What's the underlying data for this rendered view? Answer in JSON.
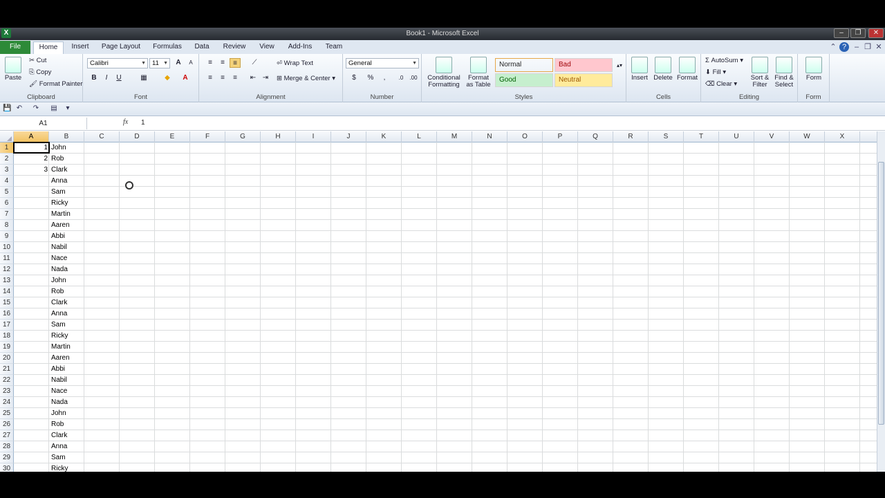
{
  "window": {
    "title": "Book1 - Microsoft Excel",
    "app_icon": "X"
  },
  "tabs": [
    "File",
    "Home",
    "Insert",
    "Page Layout",
    "Formulas",
    "Data",
    "Review",
    "View",
    "Add-Ins",
    "Team"
  ],
  "active_tab": "Home",
  "ribbon": {
    "clipboard": {
      "label": "Clipboard",
      "paste": "Paste",
      "cut": "Cut",
      "copy": "Copy",
      "format_painter": "Format Painter"
    },
    "font": {
      "label": "Font",
      "name": "Calibri",
      "size": "11",
      "bold": "B",
      "italic": "I",
      "underline": "U"
    },
    "alignment": {
      "label": "Alignment",
      "wrap": "Wrap Text",
      "merge": "Merge & Center"
    },
    "number": {
      "label": "Number",
      "format": "General",
      "percent": "%",
      "comma": ","
    },
    "styles": {
      "label": "Styles",
      "conditional": "Conditional Formatting",
      "format_table": "Format as Table",
      "normal": "Normal",
      "bad": "Bad",
      "good": "Good",
      "neutral": "Neutral",
      "colors": {
        "bad": "#ffc7ce",
        "good": "#c6efce",
        "neutral": "#ffeb9c",
        "normal": "#ffffff"
      }
    },
    "cells": {
      "label": "Cells",
      "insert": "Insert",
      "delete": "Delete",
      "format": "Format"
    },
    "editing": {
      "label": "Editing",
      "autosum": "AutoSum",
      "fill": "Fill",
      "clear": "Clear",
      "sort": "Sort & Filter",
      "find": "Find & Select"
    },
    "form": {
      "label": "Form",
      "form": "Form"
    }
  },
  "formula_bar": {
    "name_box": "A1",
    "fx": "fx",
    "value": "1"
  },
  "columns": [
    "A",
    "B",
    "C",
    "D",
    "E",
    "F",
    "G",
    "H",
    "I",
    "J",
    "K",
    "L",
    "M",
    "N",
    "O",
    "P",
    "Q",
    "R",
    "S",
    "T",
    "U",
    "V",
    "W",
    "X"
  ],
  "rows": [
    {
      "n": "1",
      "a": "1",
      "b": "John"
    },
    {
      "n": "2",
      "a": "2",
      "b": "Rob"
    },
    {
      "n": "3",
      "a": "3",
      "b": "Clark"
    },
    {
      "n": "4",
      "a": "",
      "b": "Anna"
    },
    {
      "n": "5",
      "a": "",
      "b": "Sam"
    },
    {
      "n": "6",
      "a": "",
      "b": "Ricky"
    },
    {
      "n": "7",
      "a": "",
      "b": "Martin"
    },
    {
      "n": "8",
      "a": "",
      "b": "Aaren"
    },
    {
      "n": "9",
      "a": "",
      "b": "Abbi"
    },
    {
      "n": "10",
      "a": "",
      "b": "Nabil"
    },
    {
      "n": "11",
      "a": "",
      "b": "Nace"
    },
    {
      "n": "12",
      "a": "",
      "b": "Nada"
    },
    {
      "n": "13",
      "a": "",
      "b": "John"
    },
    {
      "n": "14",
      "a": "",
      "b": "Rob"
    },
    {
      "n": "15",
      "a": "",
      "b": "Clark"
    },
    {
      "n": "16",
      "a": "",
      "b": "Anna"
    },
    {
      "n": "17",
      "a": "",
      "b": "Sam"
    },
    {
      "n": "18",
      "a": "",
      "b": "Ricky"
    },
    {
      "n": "19",
      "a": "",
      "b": "Martin"
    },
    {
      "n": "20",
      "a": "",
      "b": "Aaren"
    },
    {
      "n": "21",
      "a": "",
      "b": "Abbi"
    },
    {
      "n": "22",
      "a": "",
      "b": "Nabil"
    },
    {
      "n": "23",
      "a": "",
      "b": "Nace"
    },
    {
      "n": "24",
      "a": "",
      "b": "Nada"
    },
    {
      "n": "25",
      "a": "",
      "b": "John"
    },
    {
      "n": "26",
      "a": "",
      "b": "Rob"
    },
    {
      "n": "27",
      "a": "",
      "b": "Clark"
    },
    {
      "n": "28",
      "a": "",
      "b": "Anna"
    },
    {
      "n": "29",
      "a": "",
      "b": "Sam"
    },
    {
      "n": "30",
      "a": "",
      "b": "Ricky"
    }
  ]
}
